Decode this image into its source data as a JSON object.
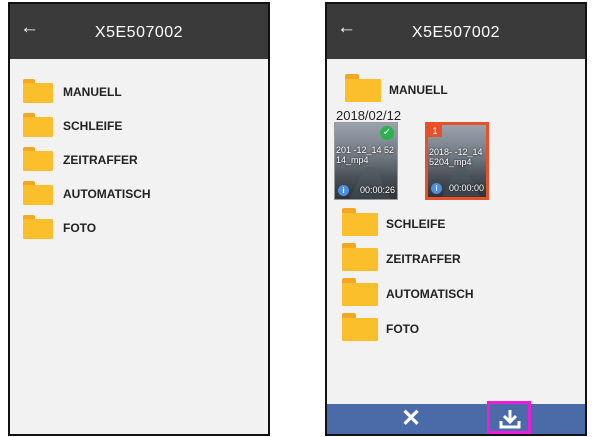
{
  "left_screen": {
    "title": "X5E507002",
    "back_icon": "arrow-left-icon",
    "folders": [
      "MANUELL",
      "SCHLEIFE",
      "ZEITRAFFER",
      "AUTOMATISCH",
      "FOTO"
    ]
  },
  "right_screen": {
    "title": "X5E507002",
    "back_icon": "arrow-left-icon",
    "top_folder": "MANUELL",
    "date_header": "2018/02/12",
    "videos": [
      {
        "name": "2018-02-12_145214_mp4",
        "name_shown": "201 -12_14 5214_mp4",
        "duration": "00:00:26",
        "selected": true
      },
      {
        "name": "2018-02-12_145204_mp4",
        "name_shown": "2018- -12_14 5204_mp4",
        "duration": "00:00:00",
        "badge": "1",
        "selected": false
      }
    ],
    "folders": [
      "SCHLEIFE",
      "ZEITRAFFER",
      "AUTOMATISCH",
      "FOTO"
    ],
    "bottom_bar": {
      "cancel_icon": "close-icon",
      "download_icon": "download-icon"
    }
  },
  "colors": {
    "appbar": "#3a3a3a",
    "folder": "#fbbf2b",
    "bottom_bar": "#4a6aa8",
    "highlight": "#e81ed8",
    "selected_border": "#e8502a",
    "check": "#2ab24f"
  }
}
